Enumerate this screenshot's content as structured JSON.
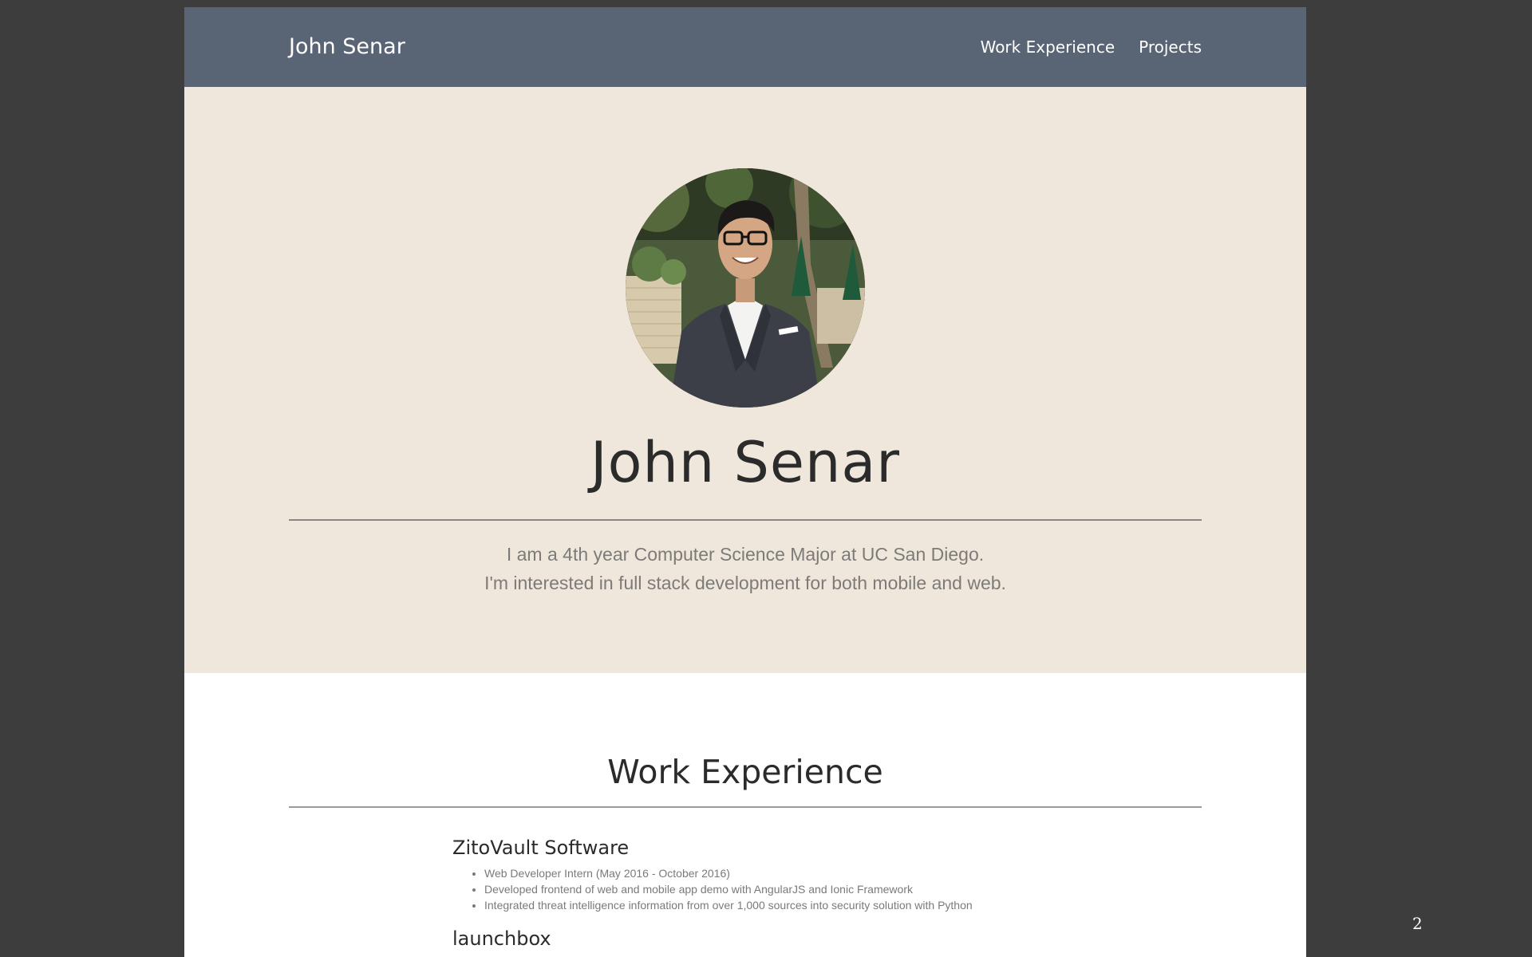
{
  "navbar": {
    "brand": "John Senar",
    "links": [
      "Work Experience",
      "Projects"
    ]
  },
  "hero": {
    "name": "John Senar",
    "bio_lines": [
      "I am a 4th year Computer Science Major at UC San Diego.",
      "I'm interested in full stack development for both mobile and web."
    ]
  },
  "work_experience": {
    "title": "Work Experience",
    "jobs": [
      {
        "company": "ZitoVault Software",
        "bullets": [
          "Web Developer Intern (May 2016 - October 2016)",
          "Developed frontend of web and mobile app demo with AngularJS and Ionic Framework",
          "Integrated threat intelligence information from over 1,000 sources into security solution with Python"
        ]
      },
      {
        "company": "launchbox",
        "bullets": []
      }
    ]
  },
  "slide_number": "2",
  "colors": {
    "navbar_bg": "#596474",
    "hero_bg": "#efe7dc",
    "outer_bg": "#3d3d3d"
  }
}
